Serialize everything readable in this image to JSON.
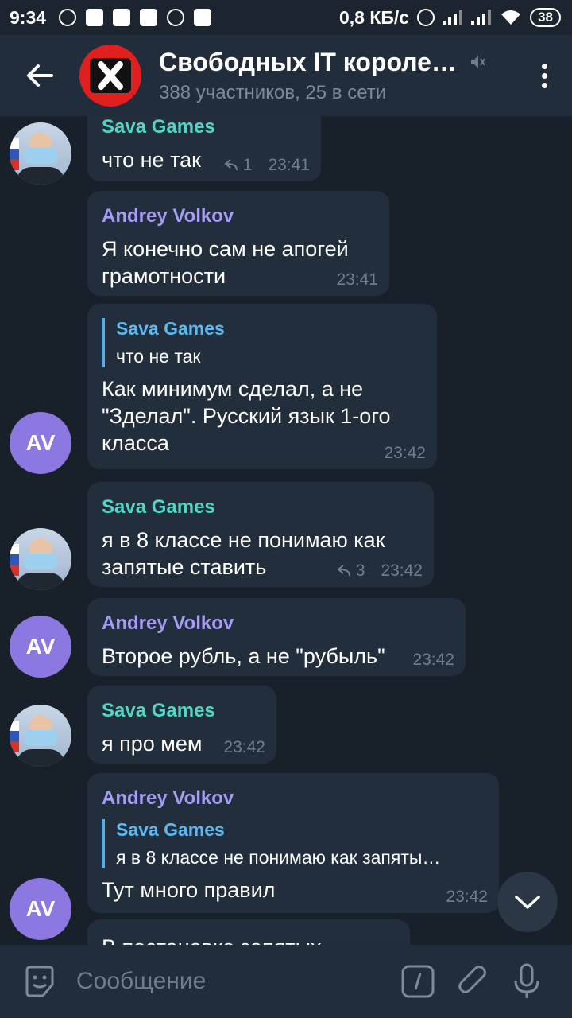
{
  "status": {
    "time": "9:34",
    "speed": "0,8 КБ/с",
    "battery": "38"
  },
  "header": {
    "title": "Свободных IT королей…",
    "subtitle": "388 участников, 25 в сети"
  },
  "messages": [
    {
      "sender": "Sava Games",
      "text": "что не так",
      "replies": "1",
      "time": "23:41"
    },
    {
      "sender": "Andrey Volkov",
      "text": "Я конечно сам не апогей грамотности",
      "time": "23:41"
    },
    {
      "reply_to": "Sava Games",
      "reply_text": "что не так",
      "text": "Как минимум сделал, а не \"Зделал\". Русский язык 1-ого класса",
      "time": "23:42"
    },
    {
      "sender": "Sava Games",
      "text": "я в 8 классе не понимаю как запятые ставить",
      "replies": "3",
      "time": "23:42"
    },
    {
      "sender": "Andrey Volkov",
      "text": "Второе рубль, а не \"рубыль\"",
      "time": "23:42"
    },
    {
      "sender": "Sava Games",
      "text": "я про мем",
      "time": "23:42"
    },
    {
      "sender": "Andrey Volkov",
      "reply_to": "Sava Games",
      "reply_text": "я в 8 классе не понимаю как запяты…",
      "text": "Тут много правил",
      "time": "23:42"
    },
    {
      "text": "В постановке запятых"
    }
  ],
  "avatars": {
    "andrey_initials": "AV"
  },
  "input": {
    "placeholder": "Сообщение"
  },
  "colors": {
    "sava_name": "#52d6c4",
    "andrey_name": "#a59cf4",
    "reply_accent": "#5aaee6",
    "av_avatar": "#8c78e0"
  }
}
